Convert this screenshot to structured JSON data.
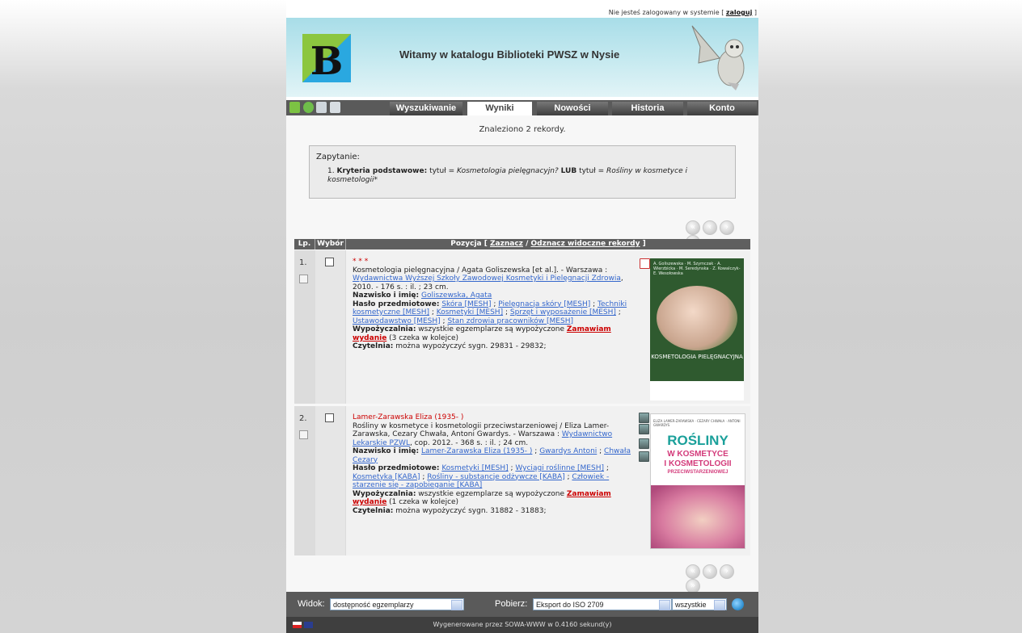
{
  "header": {
    "login_status": "Nie jesteś zalogowany w systemie",
    "login_link": "zaloguj",
    "title": "Witamy w katalogu Biblioteki PWSZ w Nysie"
  },
  "tabs": [
    {
      "label": "Wyszukiwanie",
      "active": false
    },
    {
      "label": "Wyniki",
      "active": true
    },
    {
      "label": "Nowości",
      "active": false
    },
    {
      "label": "Historia",
      "active": false
    },
    {
      "label": "Konto",
      "active": false
    }
  ],
  "results": {
    "found_text": "Znaleziono 2 rekordy.",
    "query_label": "Zapytanie:",
    "query_num": "1.",
    "query_criteria_label": "Kryteria podstawowe:",
    "query_part1": "tytuł =",
    "query_value1": "Kosmetologia pielęgnacyjn?",
    "query_or": "LUB",
    "query_part2": "tytuł =",
    "query_value2": "Rośliny w kosmetyce i kosmetologii*"
  },
  "table": {
    "col_lp": "Lp.",
    "col_wybor": "Wybór",
    "col_pozycja": "Pozycja",
    "mark": "Zaznacz",
    "unmark": "Odznacz widoczne rekordy"
  },
  "records": [
    {
      "num": "1.",
      "stars": "* * *",
      "desc": "Kosmetologia pielęgnacyjna / Agata Goliszewska [et al.]. - Warszawa :",
      "publisher": "Wydawnictwa Wyższej Szkoły Zawodowej Kosmetyki i Pielęgnacji Zdrowia",
      "desc_end": ", 2010. - 176 s. : il. ; 23 cm.",
      "name_label": "Nazwisko i imię:",
      "name": "Goliszewska, Agata",
      "subjects_label": "Hasło przedmiotowe:",
      "subjects": [
        "Skóra [MESH]",
        "Pielęgnacja skóry [MESH]",
        "Techniki kosmetyczne [MESH]",
        "Kosmetyki [MESH]",
        "Sprzęt i wyposażenie [MESH]",
        "Ustawodawstwo [MESH]",
        "Stan zdrowia pracowników [MESH]"
      ],
      "loan_label": "Wypożyczalnia:",
      "loan_text": "wszystkie egzemplarze są wypożyczone",
      "order": "Zamawiam wydanie",
      "queue": "(3 czeka w kolejce)",
      "reading_label": "Czytelnia:",
      "reading_text": "można wypożyczyć sygn. 29831 - 29832;",
      "cover_authors": "A. Goliszewska · M. Szymczak · A. Wierzbicka · M. Seredynska · Z. Kowalczyk-E. Wesołowska",
      "cover_title": "KOSMETOLOGIA PIELĘGNACYJNA"
    },
    {
      "num": "2.",
      "author": "Lamer-Zarawska Eliza (1935- )",
      "desc": "Rośliny w kosmetyce i kosmetologii przeciwstarzeniowej / Eliza Lamer-Zarawska, Cezary Chwała, Antoni Gwardys. - Warszawa :",
      "publisher": "Wydawnictwo Lekarskie PZWL",
      "desc_end": ", cop. 2012. - 368 s. : il. ; 24 cm.",
      "name_label": "Nazwisko i imię:",
      "names": [
        "Lamer-Zarawska Eliza (1935- )",
        "Gwardys Antoni",
        "Chwała Cezary"
      ],
      "subjects_label": "Hasło przedmiotowe:",
      "subjects": [
        "Kosmetyki [MESH]",
        "Wyciągi roślinne [MESH]",
        "Kosmetyka [KABA]",
        "Rośliny - substancje odżywcze [KABA]",
        "Człowiek - starzenie się - zapobieganie [KABA]"
      ],
      "loan_label": "Wypożyczalnia:",
      "loan_text": "wszystkie egzemplarze są wypożyczone",
      "order": "Zamawiam wydanie",
      "queue": "(1 czeka w kolejce)",
      "reading_label": "Czytelnia:",
      "reading_text": "można wypożyczyć sygn. 31882 - 31883;",
      "cover_authors": "ELIZA LAMER-ZARAWSKA · CEZARY CHWAŁA · ANTONI GWARDYS",
      "cover_title1": "ROŚLINY",
      "cover_title2": "W KOSMETYCE",
      "cover_title3": "I KOSMETOLOGII",
      "cover_title4": "PRZECIWSTARZENIOWEJ"
    }
  ],
  "bottom": {
    "view_label": "Widok:",
    "view_value": "dostępność egzemplarzy",
    "download_label": "Pobierz:",
    "download_value": "Eksport do ISO 2709",
    "scope_value": "wszystkie"
  },
  "footer": {
    "text": "Wygenerowane przez SOWA-WWW w 0.4160 sekund(y)"
  },
  "colors": {
    "banner": "#a8dde8",
    "navbar": "#5a5a5a",
    "link": "#3366cc",
    "accent_red": "#cc0000"
  }
}
